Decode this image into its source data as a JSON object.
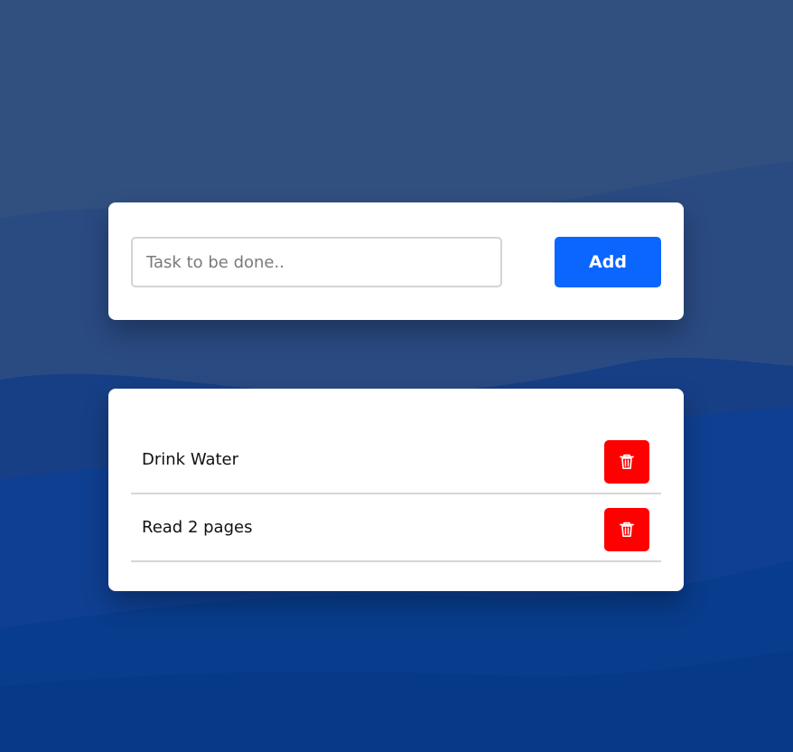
{
  "page": {
    "background_color": "#2f4f82"
  },
  "task_form": {
    "input_value": "",
    "input_placeholder": "Task to be done..",
    "add_label": "Add",
    "add_color": "#0a66ff"
  },
  "tasks": [
    {
      "label": "Drink Water",
      "delete_icon": "trash-icon",
      "delete_color": "#ff0000"
    },
    {
      "label": "Read 2 pages",
      "delete_icon": "trash-icon",
      "delete_color": "#ff0000"
    }
  ]
}
